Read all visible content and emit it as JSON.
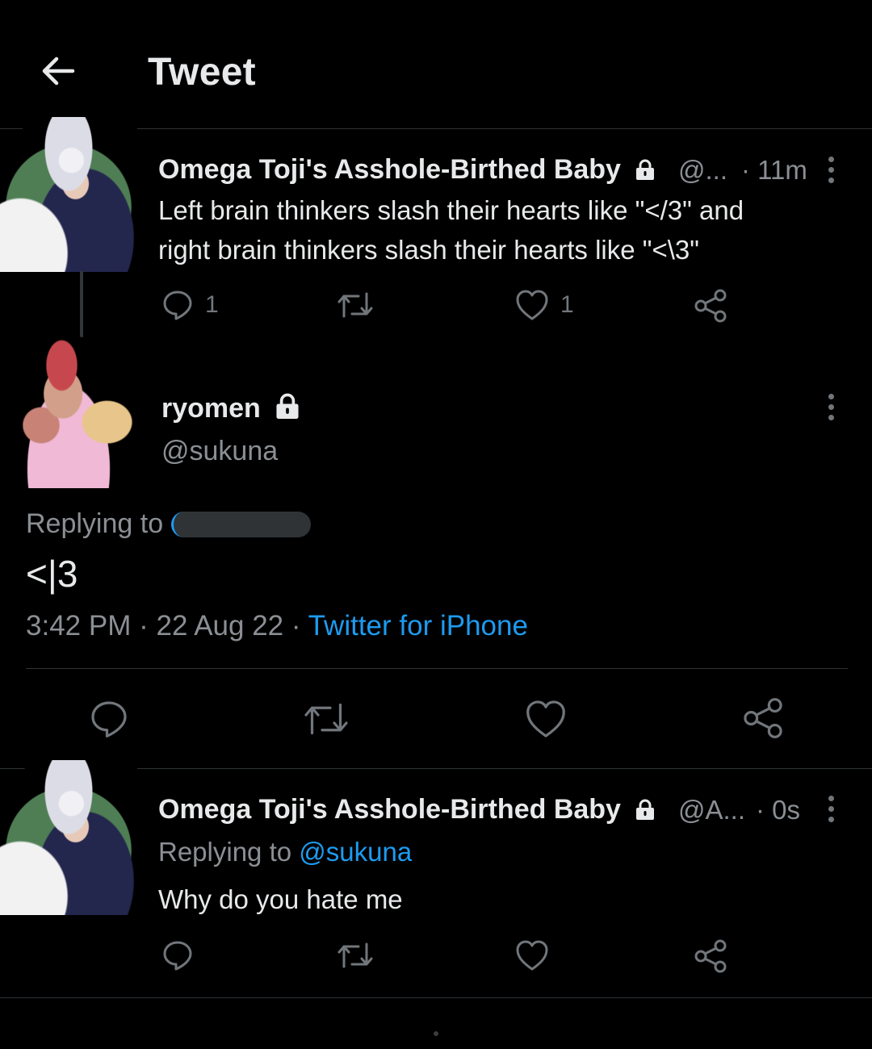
{
  "header": {
    "title": "Tweet"
  },
  "parent_tweet": {
    "display_name": "Omega Toji's Asshole-Birthed Baby",
    "handle": "@...",
    "time": "· 11m",
    "text_line1": "Left brain thinkers slash their hearts like \"</3\" and",
    "text_line2": "right brain thinkers slash their hearts like \"<\\3\"",
    "reply_count": "1",
    "like_count": "1"
  },
  "main_tweet": {
    "display_name": "ryomen",
    "handle": "@sukuna",
    "replying_label": "Replying to",
    "text": "<|3",
    "time": "3:42 PM",
    "date": "· 22 Aug 22 ·",
    "source": "Twitter for iPhone"
  },
  "reply_tweet": {
    "display_name": "Omega Toji's Asshole-Birthed Baby",
    "handle": "@A...",
    "time": "· 0s",
    "replying_label": "Replying to",
    "replying_handle": "@sukuna",
    "text": "Why do you hate me"
  },
  "icons": {
    "back": "arrow-left-icon",
    "lock": "lock-icon",
    "more": "more-vertical-icon",
    "reply": "reply-icon",
    "retweet": "retweet-icon",
    "like": "heart-icon",
    "share": "share-icon"
  },
  "colors": {
    "background": "#000000",
    "text": "#e7e9ea",
    "muted": "#71767b",
    "link": "#1d9bf0",
    "divider": "#2f3336"
  }
}
